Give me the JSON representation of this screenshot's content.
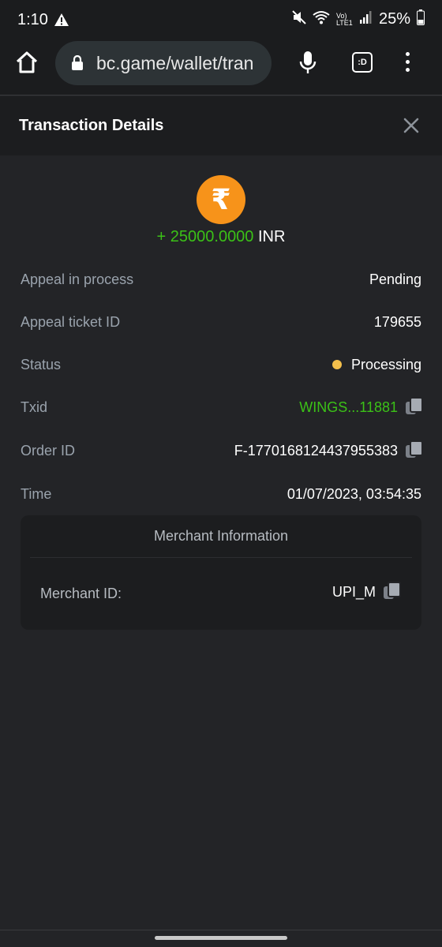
{
  "status_bar": {
    "time": "1:10",
    "network_label": "Vo) LTE1",
    "battery_percent": "25%"
  },
  "browser": {
    "url": "bc.game/wallet/tran",
    "tab_count_label": ":D"
  },
  "dialog": {
    "title": "Transaction Details"
  },
  "amount": {
    "currency_symbol": "₹",
    "value": "+ 25000.0000",
    "currency": "INR"
  },
  "details": {
    "appeal_label": "Appeal in process",
    "appeal_value": "Pending",
    "ticket_label": "Appeal ticket ID",
    "ticket_value": "179655",
    "status_label": "Status",
    "status_value": "Processing",
    "txid_label": "Txid",
    "txid_value": "WINGS...11881",
    "order_label": "Order ID",
    "order_value": "F-1770168124437955383",
    "time_label": "Time",
    "time_value": "01/07/2023, 03:54:35"
  },
  "merchant": {
    "title": "Merchant Information",
    "id_label": "Merchant ID:",
    "id_value": "UPI_M"
  },
  "colors": {
    "accent_green": "#3bc117",
    "coin_orange": "#f7931a",
    "status_yellow": "#f4c04c"
  }
}
